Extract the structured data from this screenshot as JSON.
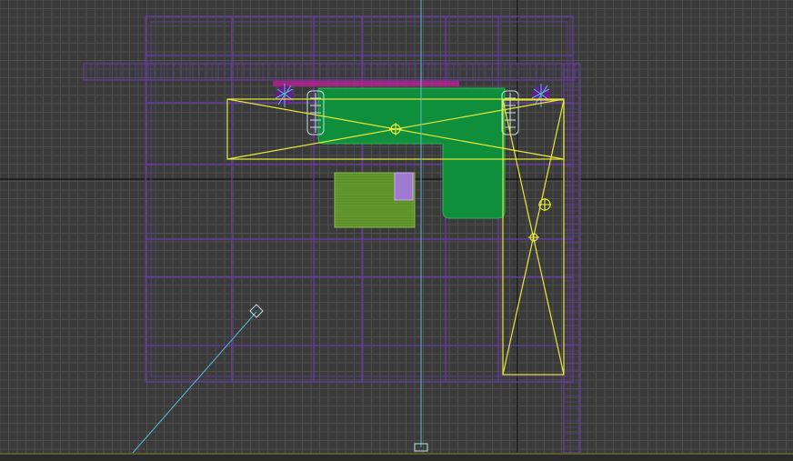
{
  "viewport": {
    "view": "Top",
    "background_color": "#3a3a3a",
    "grid_minor_color": "#4e4e4e",
    "grid_major_color": "#1f1f1f",
    "wireframe_color": "#6a3aa8",
    "selection_color": "#e6e83a",
    "sofa_color": "#0f8f3c",
    "rug_color": "#5a8f2a",
    "chair_color": "#bfe6e6",
    "camera_line_color": "#58b8d8",
    "plant_color": "#9a2aa0"
  },
  "objects": [
    {
      "name": "sofa-sectional",
      "type": "geometry",
      "selected": false
    },
    {
      "name": "rug",
      "type": "geometry",
      "selected": false
    },
    {
      "name": "wall-frame",
      "type": "geometry",
      "selected": false
    },
    {
      "name": "light-box-horizontal",
      "type": "light",
      "selected": true
    },
    {
      "name": "light-box-vertical",
      "type": "light",
      "selected": true
    },
    {
      "name": "camera",
      "type": "camera",
      "selected": false
    }
  ]
}
